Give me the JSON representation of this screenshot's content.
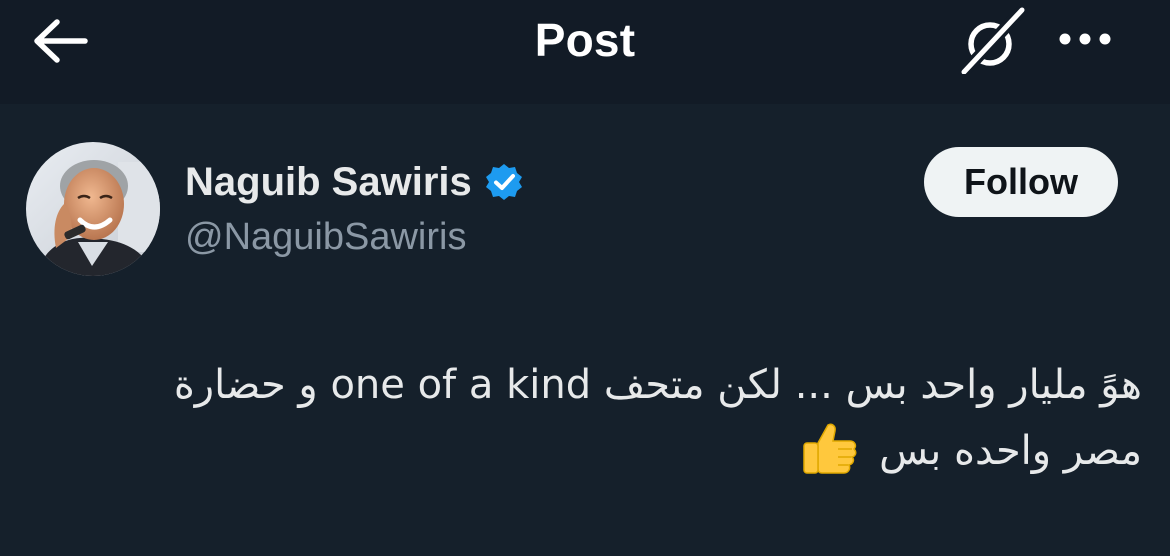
{
  "header": {
    "title": "Post",
    "back_icon": "arrow-left-icon",
    "grok_icon": "grok-icon",
    "more_icon": "more-horizontal-icon"
  },
  "author": {
    "name": "Naguib Sawiris",
    "handle": "@NaguibSawiris",
    "verified": true,
    "follow_label": "Follow"
  },
  "post": {
    "line1": "هوً مليار واحد بس ... لكن متحف one of a kind و حضارة",
    "line2": "مصر واحده بس",
    "emoji": "thumbs-up-icon"
  },
  "colors": {
    "background": "#15202b",
    "header_background": "#121b26",
    "text_primary": "#e7e9ea",
    "text_secondary": "#8b98a5",
    "verified_badge": "#1d9bf0",
    "follow_button": "#eff3f4"
  }
}
